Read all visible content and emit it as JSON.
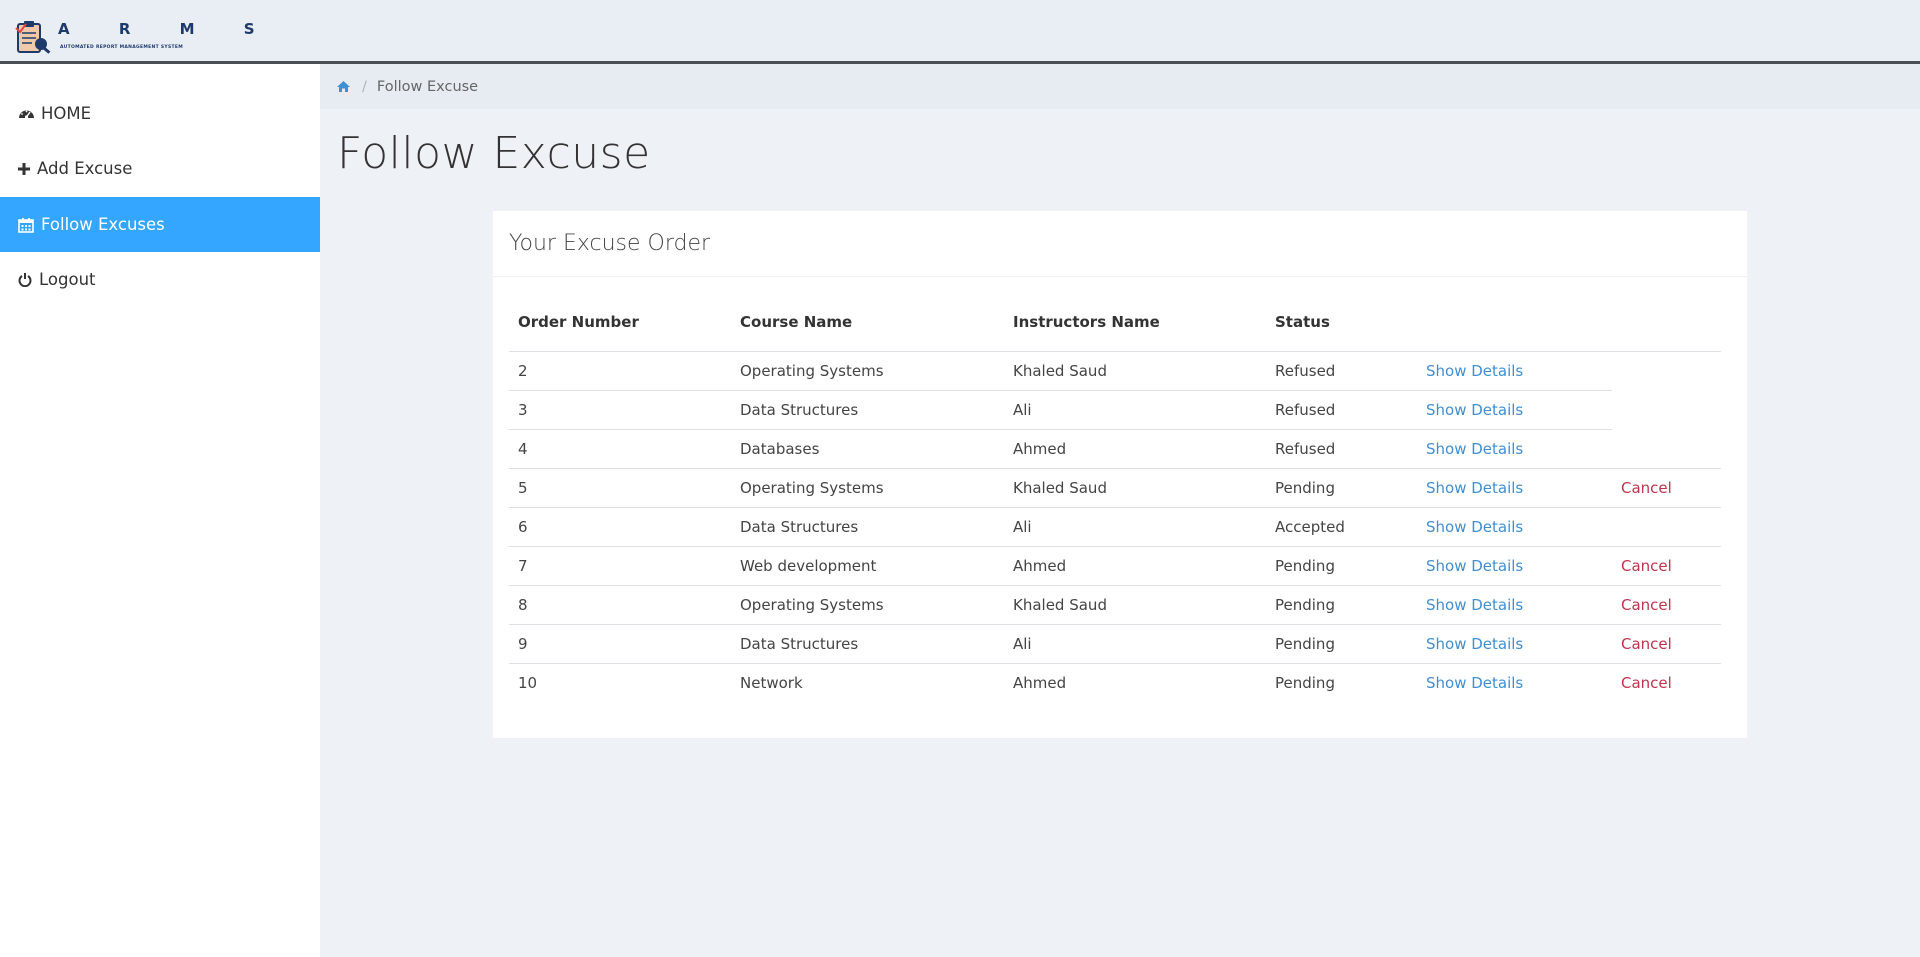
{
  "header": {
    "logo_letters": "A R M S",
    "logo_subtitle": "AUTOMATED REPORT MANAGEMENT SYSTEM"
  },
  "sidebar": {
    "items": [
      {
        "label": "HOME",
        "icon": "dashboard-icon",
        "active": false
      },
      {
        "label": "Add Excuse",
        "icon": "plus-icon",
        "active": false
      },
      {
        "label": "Follow Excuses",
        "icon": "calendar-icon",
        "active": true
      },
      {
        "label": "Logout",
        "icon": "power-icon",
        "active": false
      }
    ]
  },
  "breadcrumb": {
    "home_icon": "home-icon",
    "current": "Follow Excuse"
  },
  "page": {
    "title": "Follow Excuse"
  },
  "panel": {
    "heading": "Your Excuse Order",
    "columns": [
      "Order Number",
      "Course Name",
      "Instructors Name",
      "Status"
    ],
    "details_label": "Show Details",
    "cancel_label": "Cancel",
    "rows": [
      {
        "order": "2",
        "course": "Operating Systems",
        "instructor": "Khaled Saud",
        "status": "Refused",
        "cancel": false
      },
      {
        "order": "3",
        "course": "Data Structures",
        "instructor": "Ali",
        "status": "Refused",
        "cancel": false
      },
      {
        "order": "4",
        "course": "Databases",
        "instructor": "Ahmed",
        "status": "Refused",
        "cancel": false
      },
      {
        "order": "5",
        "course": "Operating Systems",
        "instructor": "Khaled Saud",
        "status": "Pending",
        "cancel": true
      },
      {
        "order": "6",
        "course": "Data Structures",
        "instructor": "Ali",
        "status": "Accepted",
        "cancel": false
      },
      {
        "order": "7",
        "course": "Web development",
        "instructor": "Ahmed",
        "status": "Pending",
        "cancel": true
      },
      {
        "order": "8",
        "course": "Operating Systems",
        "instructor": "Khaled Saud",
        "status": "Pending",
        "cancel": true
      },
      {
        "order": "9",
        "course": "Data Structures",
        "instructor": "Ali",
        "status": "Pending",
        "cancel": true
      },
      {
        "order": "10",
        "course": "Network",
        "instructor": "Ahmed",
        "status": "Pending",
        "cancel": true
      }
    ]
  },
  "colors": {
    "accent": "#34a6ff",
    "link": "#3f8fd4",
    "danger": "#c0334d",
    "background": "#eef2f6"
  }
}
